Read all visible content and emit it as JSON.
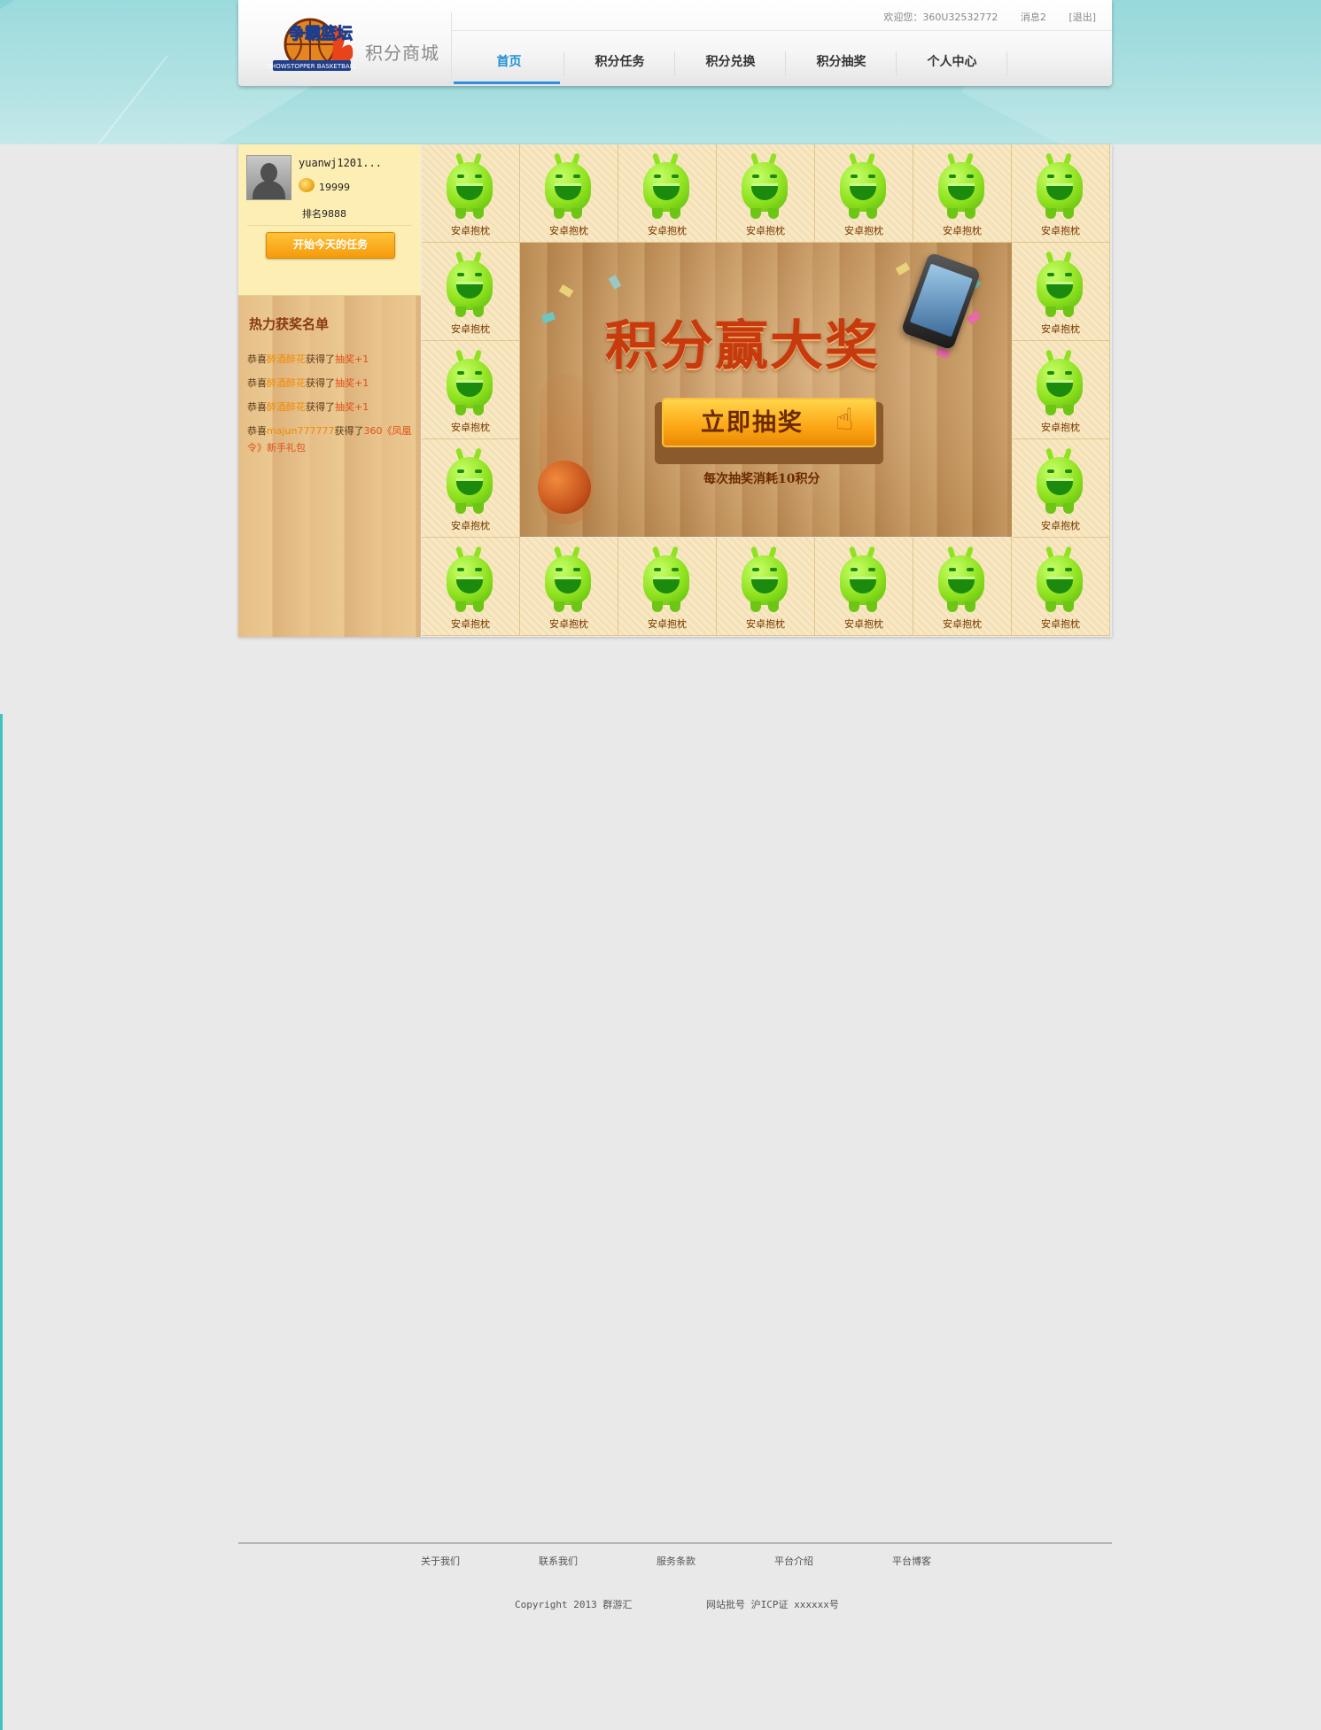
{
  "header": {
    "logo_text": "争霸篮坛",
    "logo_sub": "积分商城",
    "user": {
      "welcome": "欢迎您：360U32532772",
      "messages": "消息2",
      "logout": "[退出]"
    },
    "nav": [
      {
        "label": "首页",
        "active": true
      },
      {
        "label": "积分任务",
        "active": false
      },
      {
        "label": "积分兑换",
        "active": false
      },
      {
        "label": "积分抽奖",
        "active": false
      },
      {
        "label": "个人中心",
        "active": false
      }
    ]
  },
  "profile": {
    "username": "yuanwj1201...",
    "points": "19999",
    "rank": "排名9888",
    "task_button": "开始今天的任务"
  },
  "winners": {
    "title": "热力获奖名单",
    "items": [
      {
        "prefix": "恭喜",
        "name": "醉酒醉花",
        "mid": "获得了",
        "prize": "抽奖+1"
      },
      {
        "prefix": "恭喜",
        "name": "醉酒醉花",
        "mid": "获得了",
        "prize": "抽奖+1"
      },
      {
        "prefix": "恭喜",
        "name": "醉酒醉花",
        "mid": "获得了",
        "prize": "抽奖+1"
      },
      {
        "prefix": "恭喜",
        "name": "majun777777",
        "mid": "获得了",
        "prize": "360《凤凰令》新手礼包"
      }
    ]
  },
  "lottery": {
    "prize_label": "安卓抱枕",
    "prize_count": 20,
    "banner_title": "积分赢大奖",
    "draw_button": "立即抽奖",
    "cost_text": "每次抽奖消耗10积分",
    "icons": {
      "prize": "android-bean-icon",
      "pointer": "hand-pointer-icon"
    }
  },
  "footer": {
    "links": [
      "关于我们",
      "联系我们",
      "服务条款",
      "平台介绍",
      "平台博客"
    ],
    "copyright": "Copyright 2013 群游汇",
    "icp": "网站批号 沪ICP证 xxxxxx号"
  },
  "colors": {
    "accent": "#1e8fd6",
    "button_orange": "#f59b0c",
    "prize_text": "#7a3a00",
    "banner_title": "#c63a0e"
  }
}
